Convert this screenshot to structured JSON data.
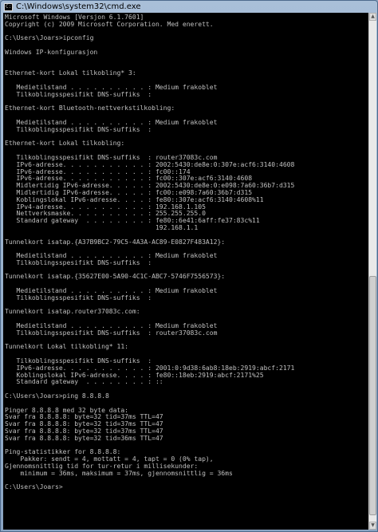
{
  "window": {
    "title": "C:\\Windows\\system32\\cmd.exe",
    "icon": "console-icon"
  },
  "console": {
    "lines": [
      "Microsoft Windows [Versjon 6.1.7601]",
      "Copyright (c) 2009 Microsoft Corporation. Med enerett.",
      "",
      "C:\\Users\\Joars>ipconfig",
      "",
      "Windows IP-konfigurasjon",
      "",
      "",
      "Ethernet-kort Lokal tilkobling* 3:",
      "",
      "   Medietilstand . . . . . . . . . . : Medium frakoblet",
      "   Tilkoblingsspesifikt DNS-suffiks  :",
      "",
      "Ethernet-kort Bluetooth-nettverkstilkobling:",
      "",
      "   Medietilstand . . . . . . . . . . : Medium frakoblet",
      "   Tilkoblingsspesifikt DNS-suffiks  :",
      "",
      "Ethernet-kort Lokal tilkobling:",
      "",
      "   Tilkoblingsspesifikt DNS-suffiks  : router37083c.com",
      "   IPv6-adresse. . . . . . . . . . . : 2002:5430:de8e:0:307e:acf6:3140:4608",
      "   IPv6-adresse. . . . . . . . . . . : fc00::174",
      "   IPv6-adresse. . . . . . . . . . . : fc00::307e:acf6:3140:4608",
      "   Midlertidig IPv6-adresse. . . . . : 2002:5430:de8e:0:e098:7a60:36b7:d315",
      "   Midlertidig IPv6-adresse. . . . . : fc00::e098:7a60:36b7:d315",
      "   Koblingslokal IPv6-adresse. . . . : fe80::307e:acf6:3140:4608%11",
      "   IPv4-adresse. . . . . . . . . . . : 192.168.1.105",
      "   Nettverksmaske. . . . . . . . . . : 255.255.255.0",
      "   Standard gateway  . . . . . . . . : fe80::6e41:6aff:fe37:83c%11",
      "                                       192.168.1.1",
      "",
      "Tunnelkort isatap.{A37B9BC2-79C5-4A3A-AC89-E0827F483A12}:",
      "",
      "   Medietilstand . . . . . . . . . . : Medium frakoblet",
      "   Tilkoblingsspesifikt DNS-suffiks  :",
      "",
      "Tunnelkort isatap.{35627E00-5A90-4C1C-ABC7-5746F7556573}:",
      "",
      "   Medietilstand . . . . . . . . . . : Medium frakoblet",
      "   Tilkoblingsspesifikt DNS-suffiks  :",
      "",
      "Tunnelkort isatap.router37083c.com:",
      "",
      "   Medietilstand . . . . . . . . . . : Medium frakoblet",
      "   Tilkoblingsspesifikt DNS-suffiks  : router37083c.com",
      "",
      "Tunnelkort Lokal tilkobling* 11:",
      "",
      "   Tilkoblingsspesifikt DNS-suffiks  :",
      "   IPv6-adresse. . . . . . . . . . . : 2001:0:9d38:6ab8:18eb:2919:abcf:2171",
      "   Koblingslokal IPv6-adresse. . . . : fe80::18eb:2919:abcf:2171%25",
      "   Standard gateway  . . . . . . . . : ::",
      "",
      "C:\\Users\\Joars>ping 8.8.8.8",
      "",
      "Pinger 8.8.8.8 med 32 byte data:",
      "Svar fra 8.8.8.8: byte=32 tid=37ms TTL=47",
      "Svar fra 8.8.8.8: byte=32 tid=37ms TTL=47",
      "Svar fra 8.8.8.8: byte=32 tid=37ms TTL=47",
      "Svar fra 8.8.8.8: byte=32 tid=36ms TTL=47",
      "",
      "Ping-statistikker for 8.8.8.8:",
      "    Pakker: sendt = 4, mottatt = 4, tapt = 0 (0% tap),",
      "Gjennomsnittlig tid for tur-retur i millisekunder:",
      "    minimum = 36ms, maksimum = 37ms, gjennomsnittlig = 36ms",
      "",
      "C:\\Users\\Joars>"
    ]
  }
}
